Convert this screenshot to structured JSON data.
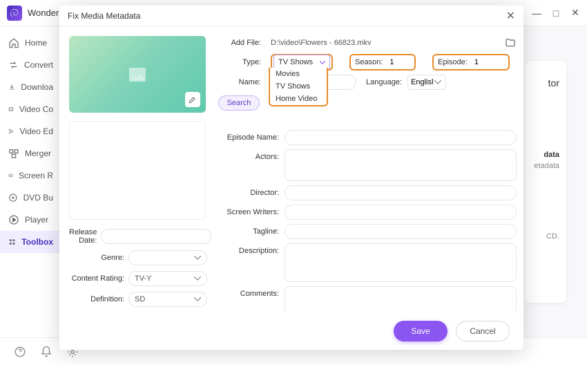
{
  "app": {
    "name": "Wonder"
  },
  "sidebar": {
    "items": [
      {
        "label": "Home"
      },
      {
        "label": "Convert"
      },
      {
        "label": "Downloa"
      },
      {
        "label": "Video Co"
      },
      {
        "label": "Video Ed"
      },
      {
        "label": "Merger"
      },
      {
        "label": "Screen R"
      },
      {
        "label": "DVD Bu"
      },
      {
        "label": "Player"
      },
      {
        "label": "Toolbox"
      }
    ]
  },
  "bg_card": {
    "line1": "tor",
    "line2": "data",
    "line3": "etadata",
    "line4": "CD."
  },
  "modal": {
    "title": "Fix Media Metadata",
    "add_file_label": "Add File:",
    "file_path": "D:\\video\\Flowers - 66823.mkv",
    "type_label": "Type:",
    "type_value": "TV Shows",
    "type_options": [
      "Movies",
      "TV Shows",
      "Home Video"
    ],
    "season_label": "Season:",
    "season_value": "1",
    "episode_label": "Episode:",
    "episode_value": "1",
    "name_label": "Name:",
    "name_value": "",
    "language_label": "Language:",
    "language_value": "English",
    "search_label": "Search",
    "fields": {
      "episode_name": "Episode Name:",
      "actors": "Actors:",
      "director": "Director:",
      "screen_writers": "Screen Writers:",
      "tagline": "Tagline:",
      "description": "Description:",
      "comments": "Comments:"
    },
    "left_meta": {
      "release_date": "Release Date:",
      "genre": "Genre:",
      "content_rating": "Content Rating:",
      "content_rating_value": "TV-Y",
      "definition": "Definition:",
      "definition_value": "SD"
    },
    "save_label": "Save",
    "cancel_label": "Cancel"
  }
}
